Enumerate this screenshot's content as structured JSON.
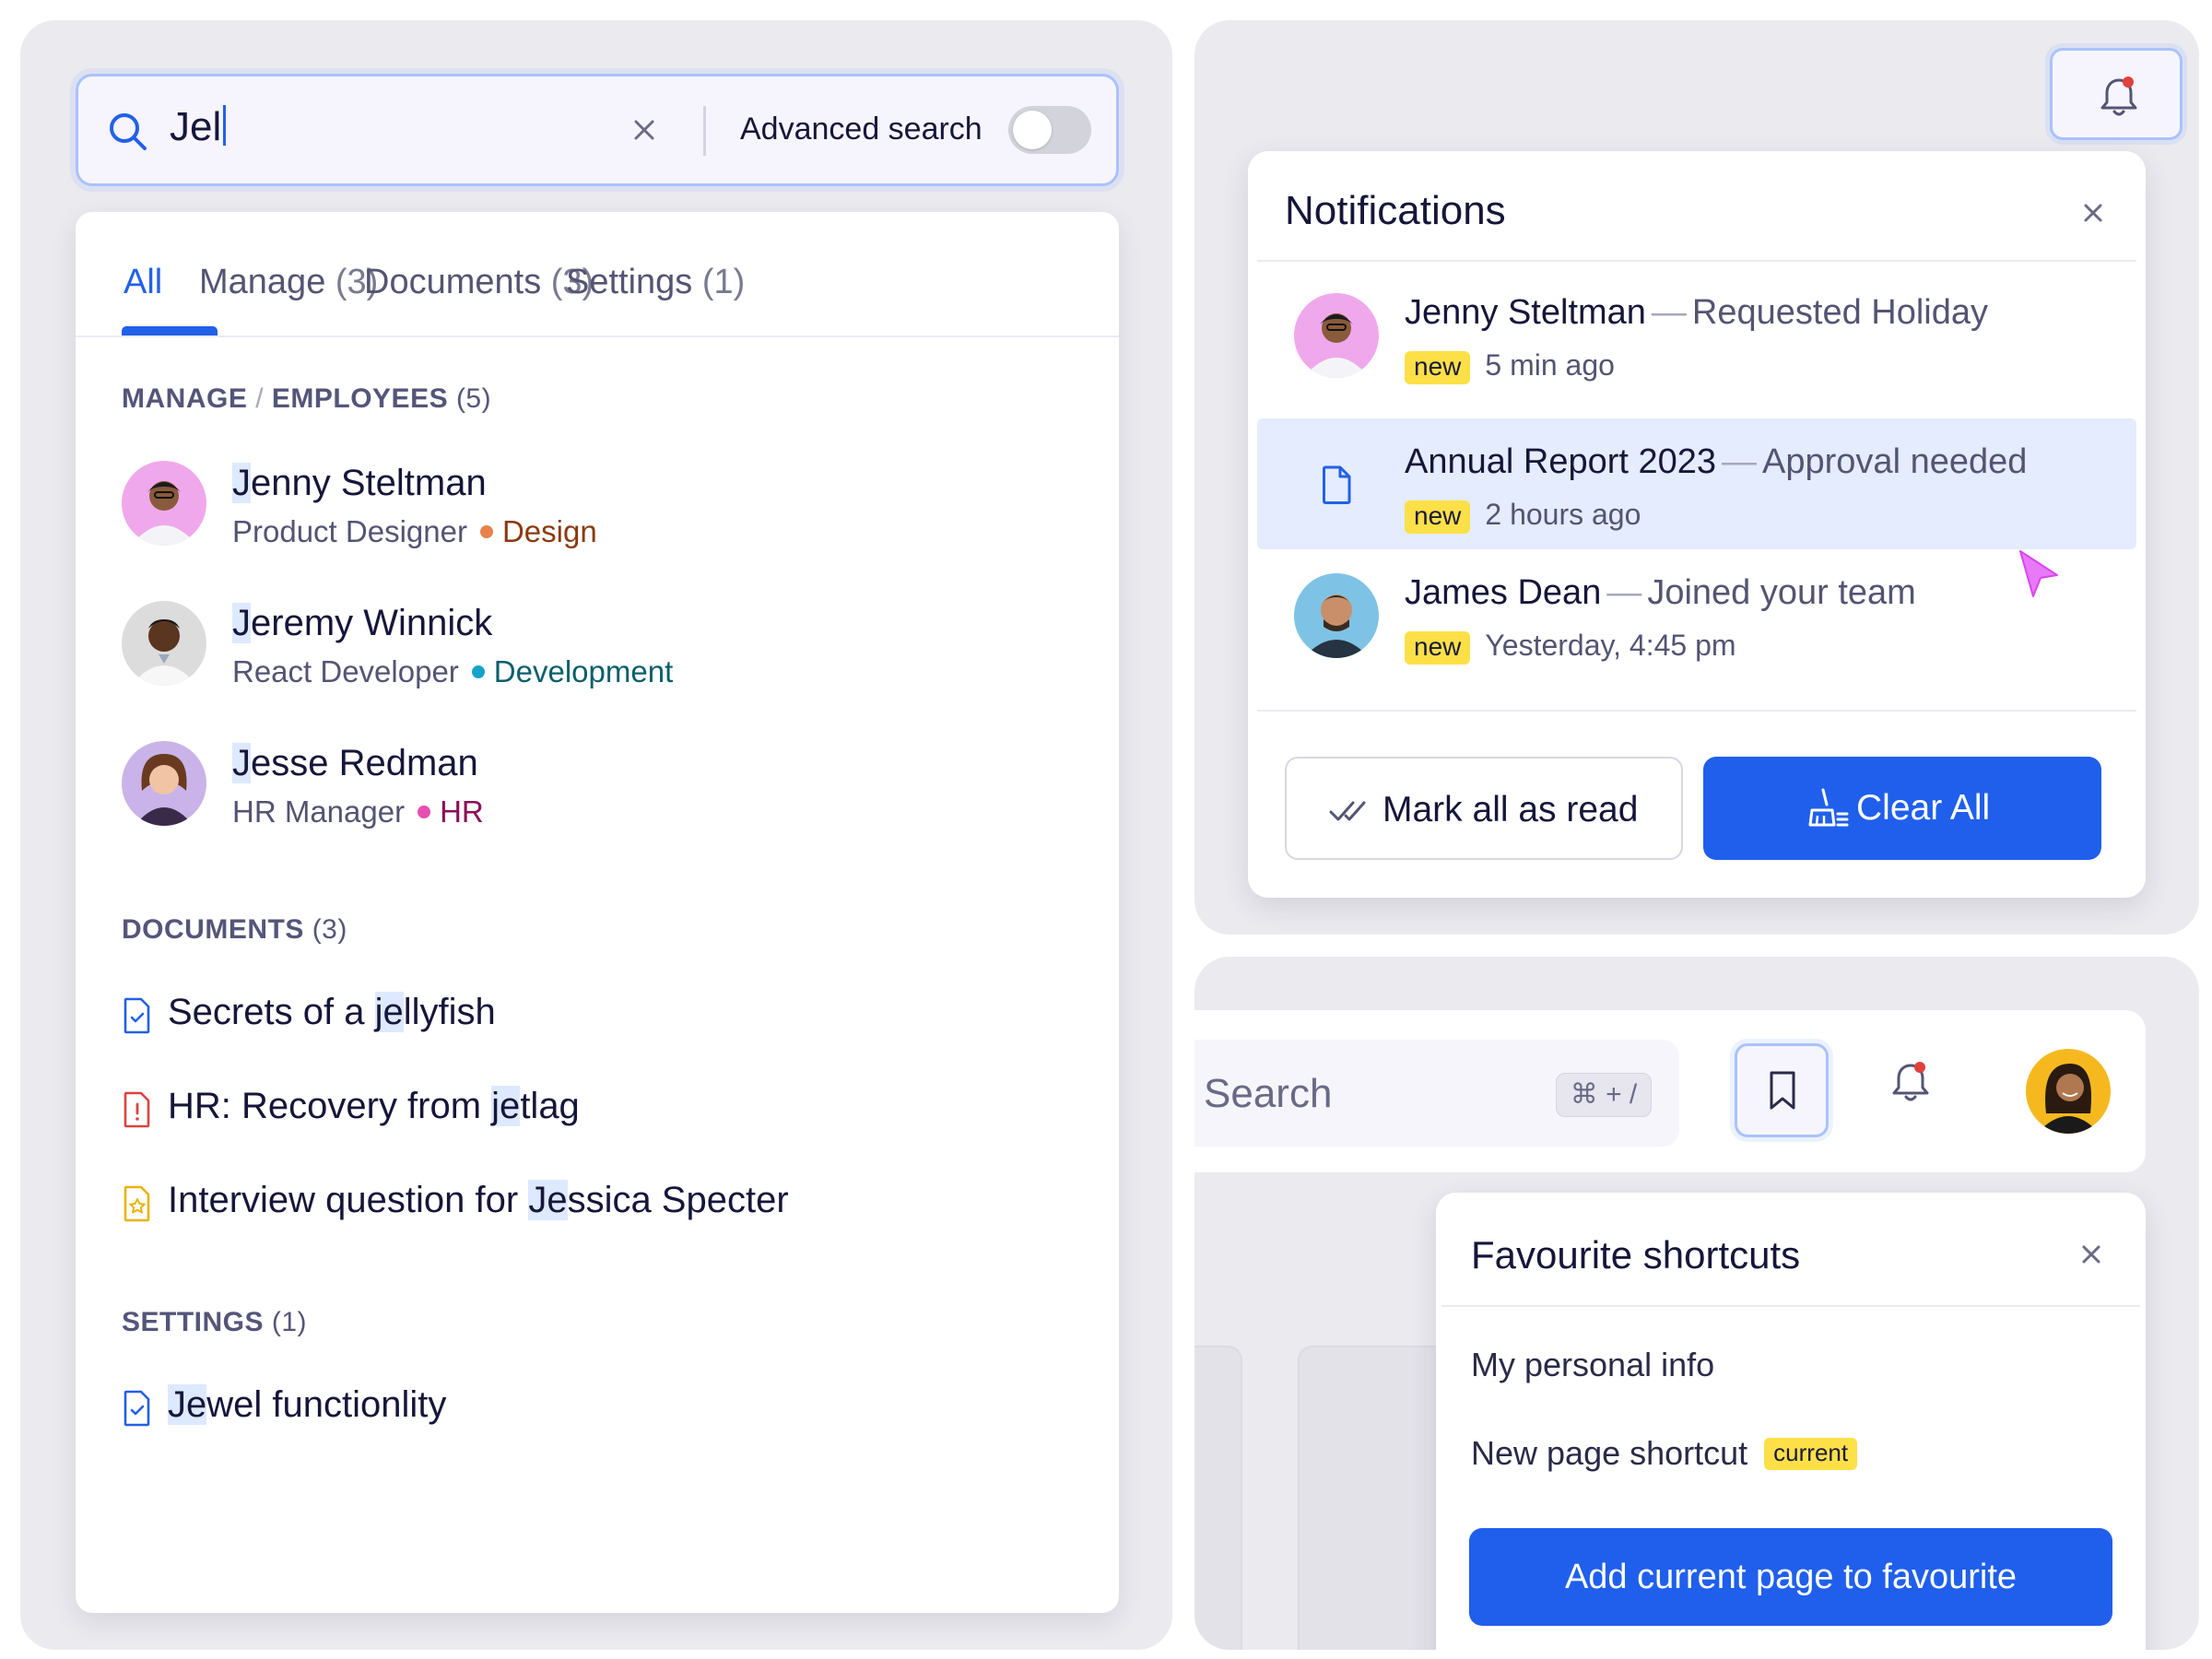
{
  "search": {
    "query": "Jel",
    "advanced_label": "Advanced search",
    "advanced_enabled": false
  },
  "tabs": [
    {
      "label": "All",
      "count": ""
    },
    {
      "label": "Manage",
      "count": "(3)"
    },
    {
      "label": "Documents",
      "count": "(3)"
    },
    {
      "label": "Settings",
      "count": "(1)"
    }
  ],
  "sections": {
    "employees": {
      "prefix": "MANAGE",
      "sep": "/",
      "name": "EMPLOYEES",
      "count": "(5)"
    },
    "documents": {
      "name": "DOCUMENTS",
      "count": "(3)"
    },
    "settings": {
      "name": "SETTINGS",
      "count": "(1)"
    }
  },
  "employees": [
    {
      "hl": "J",
      "rest": "enny Steltman",
      "role": "Product Designer",
      "dept": "Design",
      "dept_color": "#e8814a",
      "dept_text_color": "#8a3a10"
    },
    {
      "hl": "J",
      "rest": "eremy Winnick",
      "role": "React Developer",
      "dept": "Development",
      "dept_color": "#15a3c7",
      "dept_text_color": "#0b5f6b"
    },
    {
      "hl": "J",
      "rest": "esse Redman",
      "role": "HR Manager",
      "dept": "HR",
      "dept_color": "#e64fb1",
      "dept_text_color": "#8a0f58"
    }
  ],
  "documents": [
    {
      "pre": "Secrets of a ",
      "hl": "je",
      "post": "llyfish",
      "icon": "doc-check-icon",
      "color": "#2260e8"
    },
    {
      "pre": "HR: Recovery from ",
      "hl": "je",
      "post": "tlag",
      "icon": "doc-alert-icon",
      "color": "#e0413b"
    },
    {
      "pre": "Interview question for ",
      "hl": "Je",
      "post": "ssica Specter",
      "icon": "doc-star-icon",
      "color": "#eab308"
    }
  ],
  "settings_items": [
    {
      "pre": "",
      "hl": "Je",
      "post": "wel functionlity",
      "icon": "doc-check-icon",
      "color": "#2260e8"
    }
  ],
  "notifications": {
    "title": "Notifications",
    "items": [
      {
        "name": "Jenny Steltman",
        "dash": "—",
        "action": "Requested Holiday",
        "badge": "new",
        "time": "5 min ago"
      },
      {
        "name": "Annual Report 2023",
        "dash": "—",
        "action": "Approval needed",
        "badge": "new",
        "time": "2 hours ago"
      },
      {
        "name": "James Dean",
        "dash": "—",
        "action": "Joined your team",
        "badge": "new",
        "time": "Yesterday, 4:45 pm"
      }
    ],
    "mark_read_label": "Mark all as read",
    "clear_label": "Clear All"
  },
  "topbar": {
    "search_placeholder": "Search",
    "shortcut": "⌘ + /"
  },
  "favourites": {
    "title": "Favourite shortcuts",
    "items": [
      {
        "label": "My personal info",
        "badge": ""
      },
      {
        "label": "New page shortcut",
        "badge": "current"
      }
    ],
    "add_label": "Add current page to favourite"
  },
  "colors": {
    "accent": "#2260e8",
    "primary_button": "#1f5fec",
    "badge": "#fde047",
    "panel_bg": "#ebeaef"
  }
}
